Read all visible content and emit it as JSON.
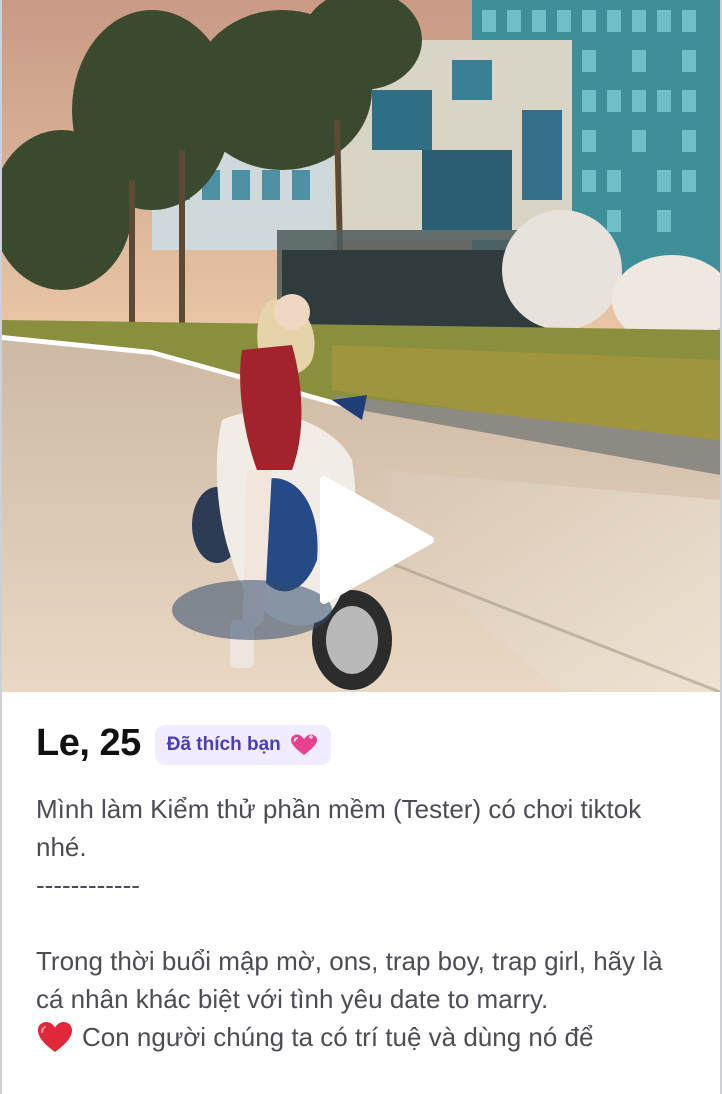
{
  "media": {
    "type": "video",
    "play_icon": "play-icon"
  },
  "profile": {
    "name_age": "Le, 25",
    "liked_badge": {
      "label": "Đã thích bạn",
      "icon": "heart-icon",
      "background": "#f1ecff",
      "text_color": "#4a3fb8"
    },
    "bio": {
      "line1": "Mình làm Kiểm thử phần mềm (Tester) có chơi tiktok nhé.",
      "divider": "------------",
      "paragraph2": "Trong thời buổi mập mờ, ons, trap boy, trap girl, hãy là cá nhân khác biệt với tình yêu date to marry.",
      "heart_line": "Con người chúng ta có trí tuệ và dùng nó để"
    }
  },
  "colors": {
    "heart": "#e0283a",
    "badge_heart": "#e8418f"
  }
}
